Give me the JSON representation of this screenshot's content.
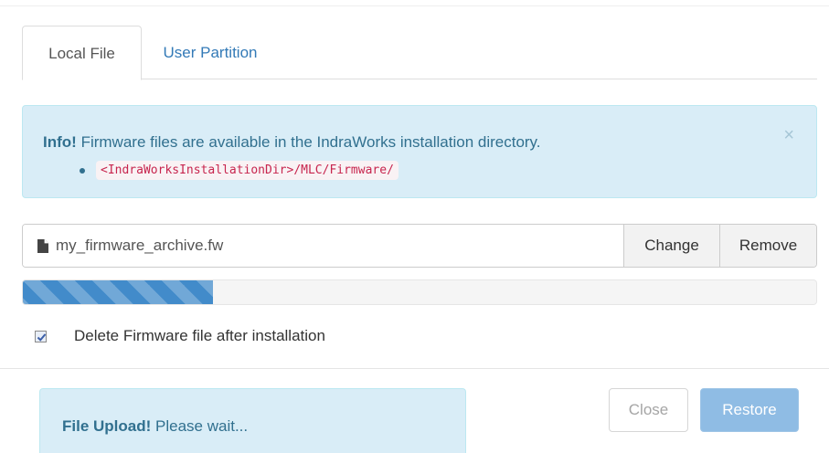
{
  "tabs": [
    {
      "label": "Local File",
      "active": true
    },
    {
      "label": "User Partition",
      "active": false
    }
  ],
  "info_alert": {
    "strong": "Info!",
    "message": "Firmware files are available in the IndraWorks installation directory.",
    "path": "<IndraWorksInstallationDir>/MLC/Firmware/",
    "close_glyph": "×"
  },
  "file_input": {
    "filename": "my_firmware_archive.fw",
    "change_label": "Change",
    "remove_label": "Remove"
  },
  "progress": {
    "fraction": 0.24
  },
  "delete_option": {
    "label": "Delete Firmware file after installation",
    "checked": true
  },
  "upload_status": {
    "strong": "File Upload!",
    "message": "Please wait..."
  },
  "footer": {
    "close_label": "Close",
    "restore_label": "Restore"
  },
  "colors": {
    "link": "#337ab7",
    "info_bg": "#d9edf7",
    "info_text": "#31708f",
    "progress": "#428bca",
    "code_text": "#c7254e",
    "primary_disabled": "#8fbce4"
  }
}
